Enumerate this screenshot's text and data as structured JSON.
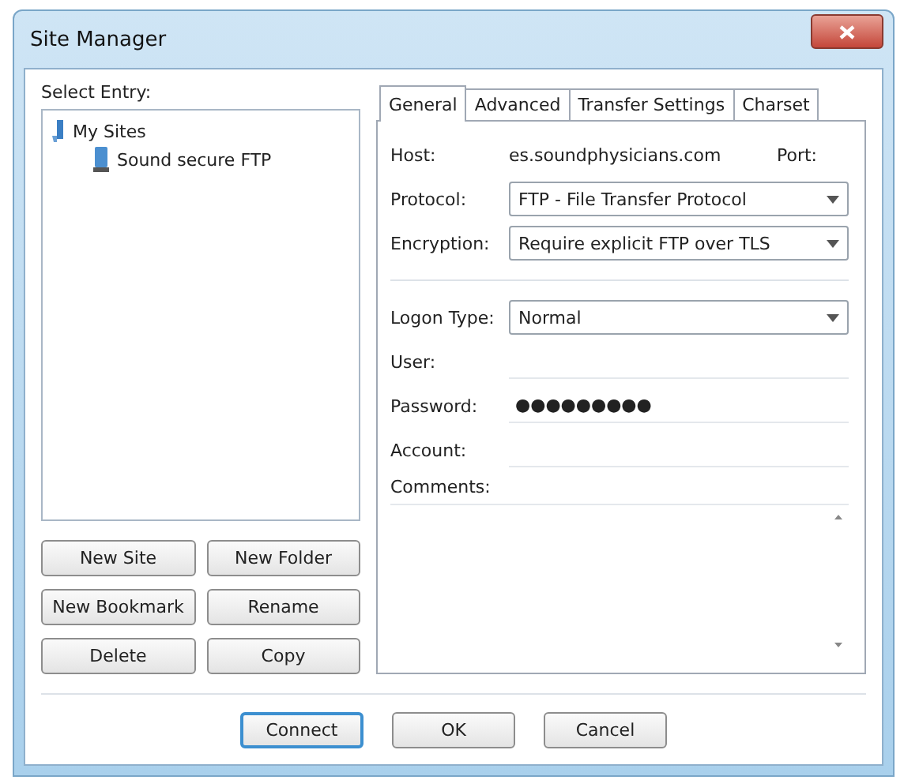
{
  "window": {
    "title": "Site Manager"
  },
  "select_entry_label": "Select Entry:",
  "tree": [
    {
      "label": "My Sites",
      "kind": "folder",
      "expanded": true,
      "children": [
        {
          "label": "Sound secure FTP",
          "kind": "site"
        }
      ]
    }
  ],
  "left_buttons": [
    "New Site",
    "New Folder",
    "New Bookmark",
    "Rename",
    "Delete",
    "Copy"
  ],
  "tabs": [
    {
      "label": "General",
      "selected": true
    },
    {
      "label": "Advanced",
      "selected": false
    },
    {
      "label": "Transfer Settings",
      "selected": false
    },
    {
      "label": "Charset",
      "selected": false
    }
  ],
  "connection_fields": [
    {
      "kind": "host",
      "label": "Host:",
      "value": "es.soundphysicians.com",
      "port_label": "Port:"
    },
    {
      "kind": "dropdown",
      "label": "Protocol:",
      "value": "FTP - File Transfer Protocol"
    },
    {
      "kind": "dropdown",
      "label": "Encryption:",
      "value": "Require explicit FTP over TLS"
    }
  ],
  "logon_fields": [
    {
      "kind": "dropdown",
      "label": "Logon Type:",
      "value": "Normal"
    },
    {
      "kind": "text",
      "label": "User:"
    },
    {
      "kind": "password",
      "label": "Password:",
      "value": "●●●●●●●●●"
    },
    {
      "kind": "text",
      "label": "Account:"
    },
    {
      "kind": "textarea",
      "label": "Comments:"
    }
  ],
  "footer_buttons": [
    {
      "label": "Connect",
      "default": true
    },
    {
      "label": "OK",
      "default": false
    },
    {
      "label": "Cancel",
      "default": false
    }
  ]
}
